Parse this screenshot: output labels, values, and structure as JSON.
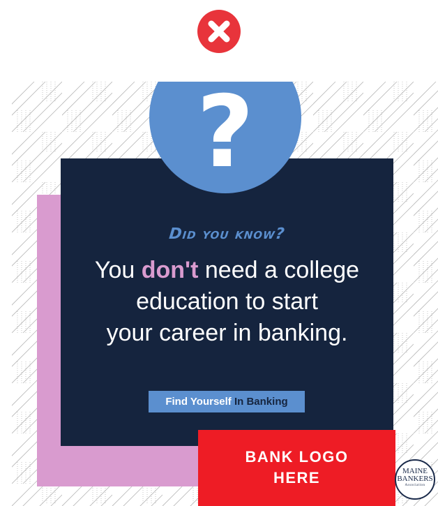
{
  "colors": {
    "navy": "#15243e",
    "blue": "#5b8fcf",
    "pink": "#d99bcf",
    "red": "#ee1c25",
    "badge_red": "#e8343b"
  },
  "badge": {
    "icon": "close-icon"
  },
  "ad": {
    "question_icon": "question-mark-icon",
    "question_glyph": "?",
    "kicker": "Did you know?",
    "headline": {
      "line1_pre": "You ",
      "line1_emph": "don't",
      "line1_post": " need a college",
      "line2": "education to start",
      "line3": "your career in banking."
    },
    "cta": {
      "label_main": "Find Yourself ",
      "label_accent": "In Banking"
    },
    "logo_placeholder": {
      "line1": "BANK LOGO",
      "line2": "HERE"
    },
    "seal": {
      "line1": "MAINE",
      "line2": "BANKERS",
      "line3": "Association"
    }
  }
}
